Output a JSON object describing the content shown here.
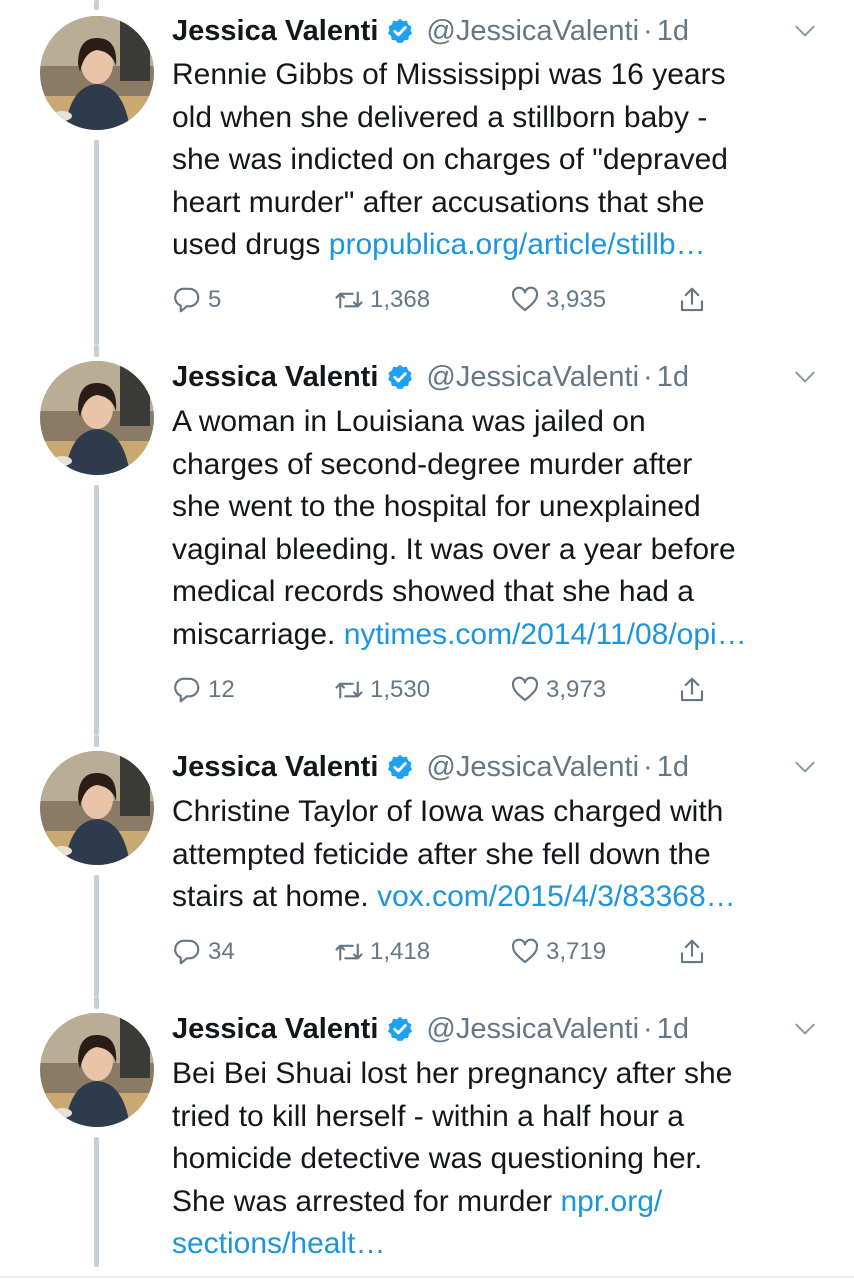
{
  "colors": {
    "text": "#14171a",
    "secondary": "#657786",
    "link": "#1b95e0",
    "verified": "#1da1f2",
    "thread_line": "#c4cfd6"
  },
  "tweets": [
    {
      "name": "Jessica Valenti",
      "handle": "@JessicaValenti",
      "separator": "·",
      "time": "1d",
      "lines": [
        "Rennie Gibbs of Mississippi was 16 years",
        "old when she delivered a stillborn baby -",
        "she was indicted on charges of \"depraved",
        "heart murder\" after accusations that she"
      ],
      "last_text": "used drugs ",
      "link": "propublica.org/article/stillb…",
      "link_break": "",
      "replies": "5",
      "retweets": "1,368",
      "likes": "3,935"
    },
    {
      "name": "Jessica Valenti",
      "handle": "@JessicaValenti",
      "separator": "·",
      "time": "1d",
      "lines": [
        "A woman in Louisiana was jailed on",
        "charges of second-degree murder after",
        "she went to the hospital for unexplained",
        "vaginal bleeding. It was over a year before",
        "medical records showed that she had a"
      ],
      "last_text": "miscarriage. ",
      "link": "nytimes.com/2014/11/08/opi…",
      "link_break": "",
      "replies": "12",
      "retweets": "1,530",
      "likes": "3,973"
    },
    {
      "name": "Jessica Valenti",
      "handle": "@JessicaValenti",
      "separator": "·",
      "time": "1d",
      "lines": [
        "Christine Taylor of Iowa was charged with",
        "attempted feticide after she fell down the"
      ],
      "last_text": "stairs at home. ",
      "link": "vox.com/2015/4/3/83368…",
      "link_break": "",
      "replies": "34",
      "retweets": "1,418",
      "likes": "3,719"
    },
    {
      "name": "Jessica Valenti",
      "handle": "@JessicaValenti",
      "separator": "·",
      "time": "1d",
      "lines": [
        "Bei Bei Shuai lost her pregnancy after she",
        "tried to kill herself - within a half hour a",
        "homicide detective was questioning her."
      ],
      "last_text": "She was arrested for murder ",
      "link": "npr.org/",
      "link_break": "sections/healt…"
    }
  ],
  "icons": {
    "avatar": "avatar-photo",
    "verified": "verified-badge-icon",
    "caret": "chevron-down-icon",
    "reply": "reply-icon",
    "retweet": "retweet-icon",
    "like": "heart-icon",
    "share": "share-icon"
  }
}
